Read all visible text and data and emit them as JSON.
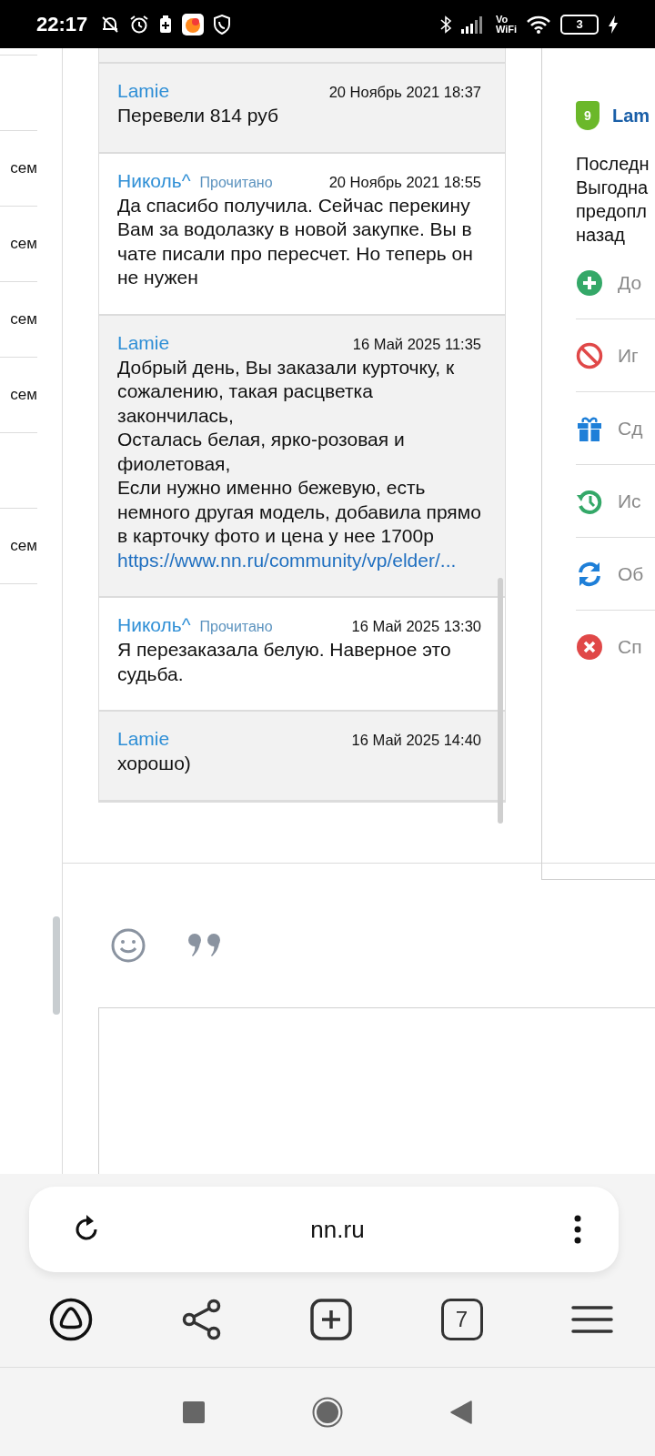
{
  "status_bar": {
    "time": "22:17",
    "vowifi": [
      "Vo",
      "WiFi"
    ],
    "battery": "3"
  },
  "left_list": [
    {
      "kind": "blank"
    },
    {
      "kind": "recipient",
      "label": "сем"
    },
    {
      "kind": "recipient",
      "label": "сем"
    },
    {
      "kind": "recipient",
      "label": "сем"
    },
    {
      "kind": "recipient",
      "label": "сем"
    },
    {
      "kind": "blank"
    },
    {
      "kind": "recipient",
      "label": "сем"
    }
  ],
  "messages": [
    {
      "kind": "incoming",
      "author": "Lamie",
      "date": "20 Ноябрь 2021 18:37",
      "text": "Перевели 814 руб"
    },
    {
      "kind": "outgoing",
      "author": "Николь^",
      "status": "Прочитано",
      "date": "20 Ноябрь 2021 18:55",
      "text": "Да спасибо получила. Сейчас перекину Вам за водолазку в новой закупке. Вы в чате писали про пересчет. Но теперь он не нужен"
    },
    {
      "kind": "incoming",
      "author": "Lamie",
      "date": "16 Май 2025 11:35",
      "text": "Добрый день, Вы заказали курточку, к сожалению, такая расцветка закончилась,\nОсталась белая, ярко-розовая и фиолетовая,\nЕсли нужно именно бежевую, есть немного другая модель, добавила прямо в карточку фото и цена у нее 1700р",
      "link": "https://www.nn.ru/community/vp/elder/..."
    },
    {
      "kind": "outgoing",
      "author": "Николь^",
      "status": "Прочитано",
      "date": "16 Май 2025 13:30",
      "text": "Я перезаказала белую. Наверное это судьба."
    },
    {
      "kind": "incoming",
      "author": "Lamie",
      "date": "16 Май 2025 14:40",
      "text": "хорошо)"
    }
  ],
  "profile": {
    "badge": "9",
    "name": "Lam",
    "lines": [
      "Последн",
      "Выгодна",
      "предопл",
      "назад"
    ],
    "actions": [
      "До",
      "Иг",
      "Сд",
      "Ис",
      "Об",
      "Сп"
    ]
  },
  "browser": {
    "url": "nn.ru",
    "tabs_count": "7"
  }
}
